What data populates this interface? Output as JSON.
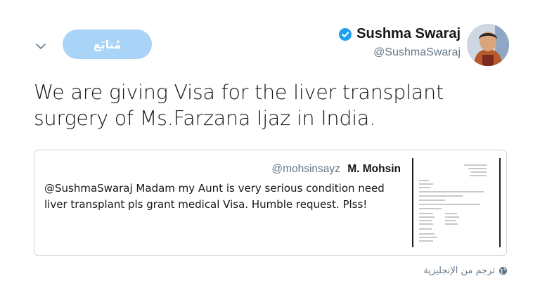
{
  "header": {
    "follow_label": "مُتابَع",
    "display_name": "Sushma Swaraj",
    "handle": "@SushmaSwaraj"
  },
  "tweet": {
    "text": "We are giving Visa for the liver transplant surgery of Ms.Farzana Ijaz in India."
  },
  "quote": {
    "name": "M. Mohsin",
    "handle": "@mohsinsayz",
    "text": "@SushmaSwaraj Madam my Aunt is very serious condition need liver transplant pls grant medical Visa. Humble request. Plss!"
  },
  "footer": {
    "translate_label": "ترجم من الإنجليزية"
  },
  "colors": {
    "follow_button": "#a9d3f7",
    "verified": "#1da1f2",
    "secondary_text": "#657786",
    "border": "#ccd6dd"
  },
  "icons": [
    "chevron-down-icon",
    "verified-badge-icon",
    "globe-icon"
  ]
}
